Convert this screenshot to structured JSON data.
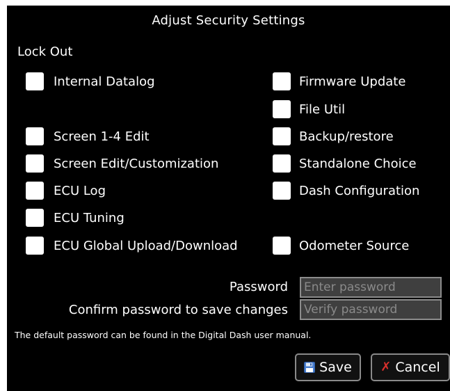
{
  "dialog": {
    "title": "Adjust Security Settings",
    "section_label": "Lock Out",
    "left_options": [
      {
        "label": "Internal Datalog",
        "checked": false
      },
      {
        "label": "Screen 1-4 Edit",
        "checked": false
      },
      {
        "label": "Screen Edit/Customization",
        "checked": false
      },
      {
        "label": "ECU Log",
        "checked": false
      },
      {
        "label": "ECU Tuning",
        "checked": false
      },
      {
        "label": "ECU Global Upload/Download",
        "checked": false
      }
    ],
    "right_options": [
      {
        "label": "Firmware Update",
        "checked": false
      },
      {
        "label": "File Util",
        "checked": false
      },
      {
        "label": "Backup/restore",
        "checked": false
      },
      {
        "label": "Standalone Choice",
        "checked": false
      },
      {
        "label": "Dash Configuration",
        "checked": false
      },
      {
        "label": "Odometer Source",
        "checked": false
      }
    ],
    "password": {
      "label": "Password",
      "placeholder": "Enter password",
      "value": ""
    },
    "confirm_password": {
      "label": "Confirm password to save changes",
      "placeholder": "Verify password",
      "value": ""
    },
    "note": "The default password can be found in the Digital Dash user manual.",
    "buttons": {
      "save_label": "Save",
      "save_icon": "floppy-disk-icon",
      "cancel_label": "Cancel",
      "cancel_icon": "x-icon",
      "cancel_icon_glyph": "✗"
    },
    "colors": {
      "background": "#000000",
      "checkbox": "#ffffff",
      "input_bg": "#3f3f3f",
      "cancel_icon": "#d9302c",
      "save_icon": "#4a7fd0"
    }
  }
}
